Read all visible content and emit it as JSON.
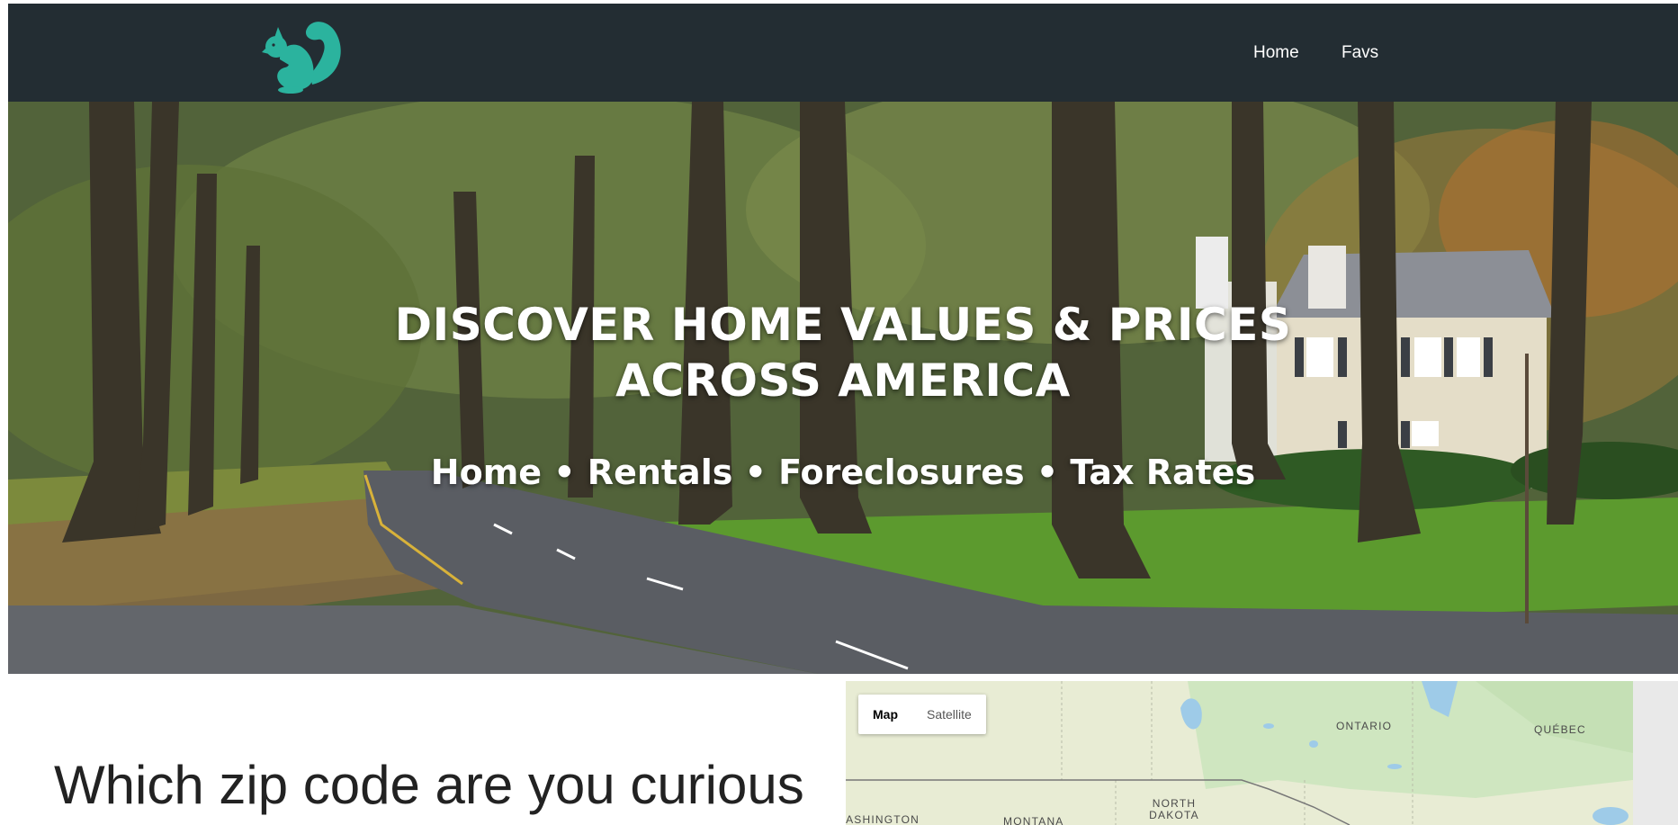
{
  "nav": {
    "links": [
      "Home",
      "Favs"
    ]
  },
  "hero": {
    "title_line1": "DISCOVER HOME VALUES & PRICES",
    "title_line2": "ACROSS AMERICA",
    "subtitle": "Home • Rentals • Foreclosures • Tax Rates"
  },
  "main": {
    "question": "Which zip code are you curious"
  },
  "map": {
    "buttons": [
      "Map",
      "Satellite"
    ],
    "selected": "Map",
    "labels": {
      "ontario": "ONTARIO",
      "quebec": "QUÉBEC",
      "north_dakota_1": "NORTH",
      "north_dakota_2": "DAKOTA",
      "montana": "MONTANA",
      "washington": "WASHINGTON"
    }
  },
  "colors": {
    "navbar": "#232d33",
    "logo": "#2bb39e",
    "nav_text": "#ffffff"
  },
  "icons": {
    "logo": "squirrel-icon"
  }
}
